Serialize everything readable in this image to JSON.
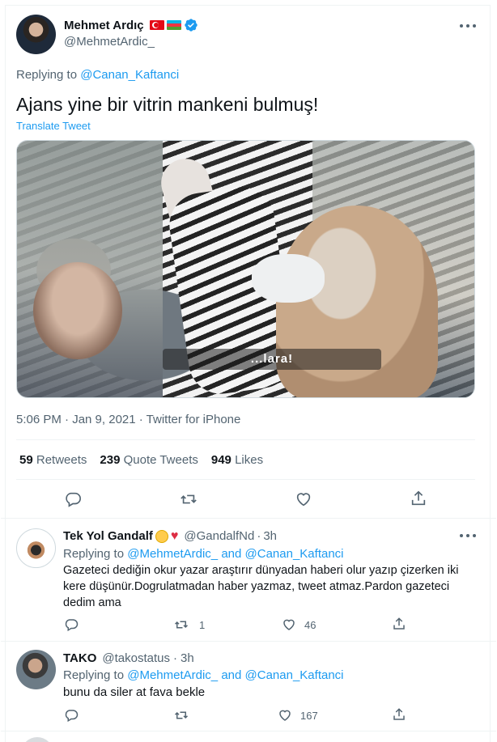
{
  "main_tweet": {
    "author_name": "Mehmet Ardıç",
    "author_handle": "@MehmetArdic_",
    "replying_prefix": "Replying to",
    "replying_to": "@Canan_Kaftanci",
    "text": "Ajans yine bir vitrin mankeni bulmuş!",
    "translate_label": "Translate Tweet",
    "video_caption": "...lara!",
    "timestamp": "5:06 PM · Jan 9, 2021 · Twitter for iPhone",
    "stats": {
      "retweets_count": "59",
      "retweets_label": "Retweets",
      "quote_count": "239",
      "quote_label": "Quote Tweets",
      "likes_count": "949",
      "likes_label": "Likes"
    },
    "flags": [
      "turkey-flag-icon",
      "azerbaijan-flag-icon"
    ],
    "verified_color": "#1d9bf0"
  },
  "replies": [
    {
      "author_name": "Tek Yol Gandalf",
      "author_handle": "@GandalfNd",
      "time": "3h",
      "replying_prefix": "Replying to",
      "replying_to_1": "@MehmetArdic_",
      "and": "and",
      "replying_to_2": "@Canan_Kaftanci",
      "text": "Gazeteci dediğin okur yazar araştırır dünyadan haberi olur yazıp çizerken iki kere düşünür.Dogrulatmadan haber yazmaz, tweet atmaz.Pardon gazeteci dedim ama",
      "reply_count": "",
      "retweet_count": "1",
      "like_count": "46",
      "emoji": [
        "angry-face-emoji",
        "red-heart-emoji"
      ]
    },
    {
      "author_name": "TAKO",
      "author_handle": "@takostatus",
      "time": "3h",
      "replying_prefix": "Replying to",
      "replying_to_1": "@MehmetArdic_",
      "and": "and",
      "replying_to_2": "@Canan_Kaftanci",
      "text": "bunu da siler at fava bekle",
      "reply_count": "",
      "retweet_count": "",
      "like_count": "167"
    }
  ],
  "colors": {
    "accent": "#1d9bf0",
    "secondary_text": "#536471",
    "like_red": "#f91880"
  }
}
